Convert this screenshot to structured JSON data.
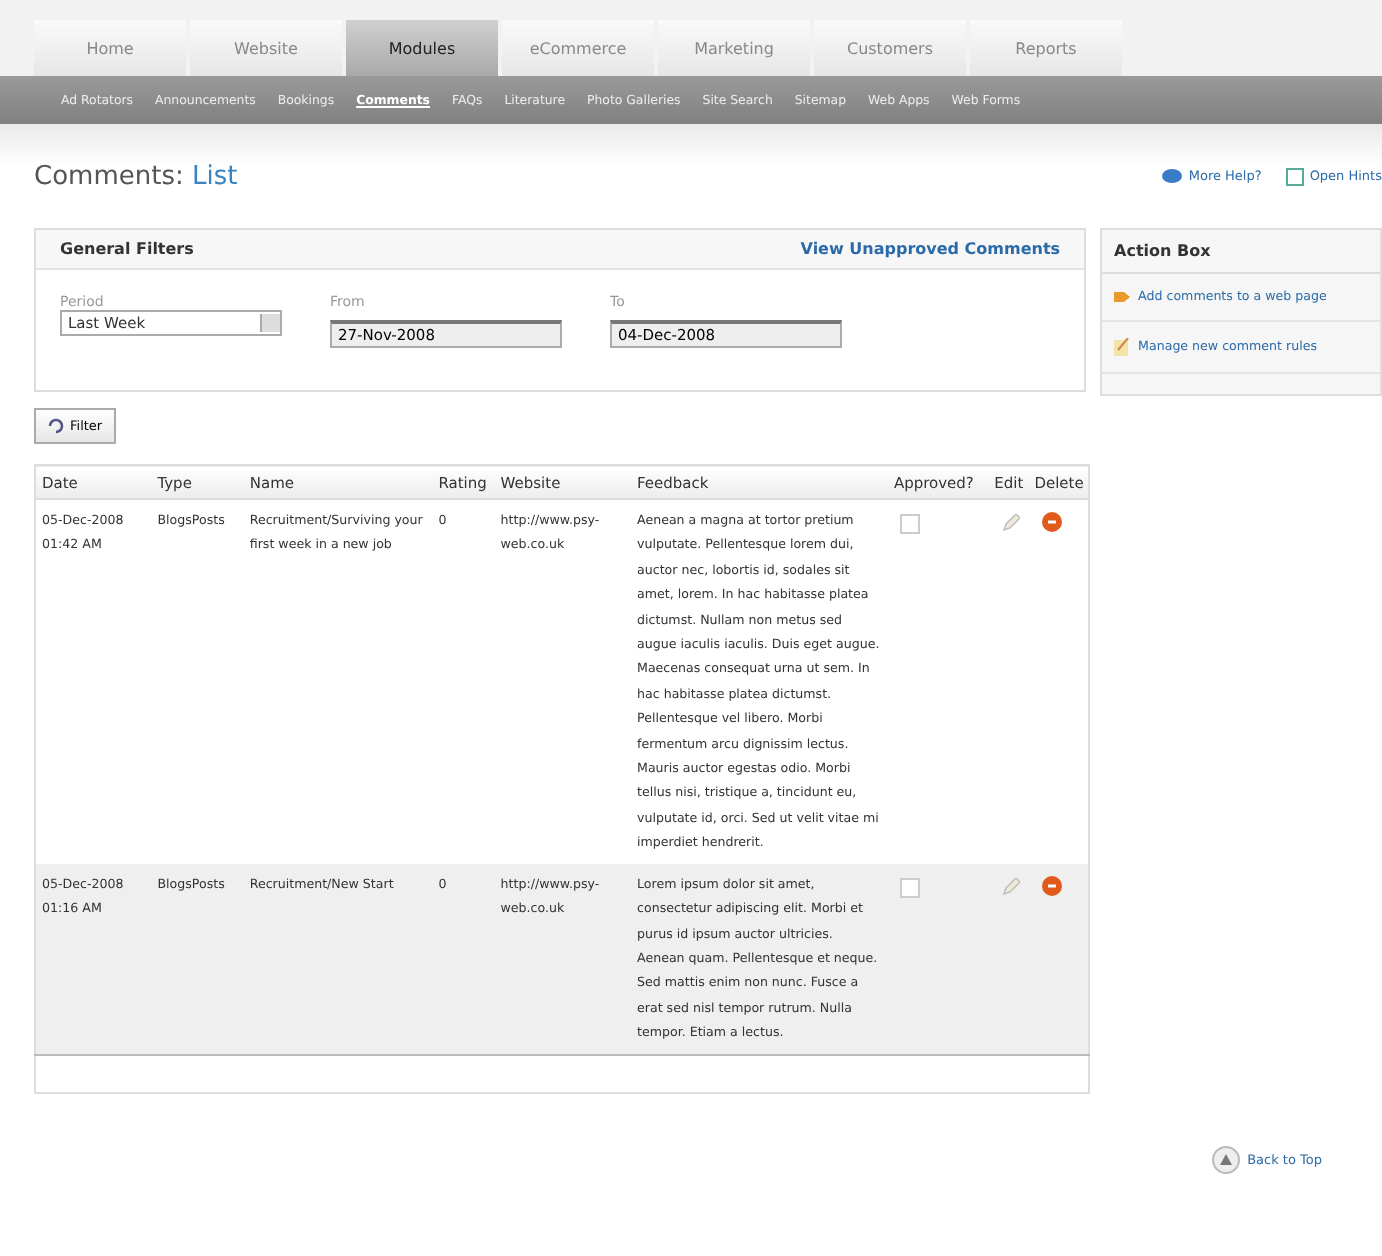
{
  "tabs": [
    {
      "label": "Home",
      "selected": false
    },
    {
      "label": "Website",
      "selected": false
    },
    {
      "label": "Modules",
      "selected": true
    },
    {
      "label": "eCommerce",
      "selected": false
    },
    {
      "label": "Marketing",
      "selected": false
    },
    {
      "label": "Customers",
      "selected": false
    },
    {
      "label": "Reports",
      "selected": false
    }
  ],
  "subnav": [
    {
      "label": "Ad Rotators",
      "selected": false
    },
    {
      "label": "Announcements",
      "selected": false
    },
    {
      "label": "Bookings",
      "selected": false
    },
    {
      "label": "Comments",
      "selected": true
    },
    {
      "label": "FAQs",
      "selected": false
    },
    {
      "label": "Literature",
      "selected": false
    },
    {
      "label": "Photo Galleries",
      "selected": false
    },
    {
      "label": "Site Search",
      "selected": false
    },
    {
      "label": "Sitemap",
      "selected": false
    },
    {
      "label": "Web Apps",
      "selected": false
    },
    {
      "label": "Web Forms",
      "selected": false
    }
  ],
  "page_title": {
    "section": "Comments:",
    "view": "List"
  },
  "help_links": [
    "More Help?",
    "Open Hints"
  ],
  "filters": {
    "title": "General Filters",
    "link": "View Unapproved Comments",
    "period": {
      "label": "Period",
      "value": "Last Week"
    },
    "from": {
      "label": "From",
      "value": "27-Nov-2008"
    },
    "to": {
      "label": "To",
      "value": "04-Dec-2008"
    }
  },
  "action_box": {
    "title": "Action Box",
    "items": [
      {
        "label": "Add comments to a web page",
        "kind": "add"
      },
      {
        "label": "Manage new comment rules",
        "kind": "manage"
      }
    ]
  },
  "filter_button": "Filter",
  "table": {
    "columns": [
      "Date",
      "Type",
      "Name",
      "Rating",
      "Website",
      "Feedback",
      "Approved?",
      "Edit",
      "Delete"
    ],
    "rows": [
      {
        "date": "05-Dec-2008 01:42 AM",
        "type": "BlogsPosts",
        "name": "Recruitment/Surviving your first week in a new job",
        "rating": "0",
        "website": "http://www.psy-web.co.uk",
        "feedback": "Aenean a magna at tortor pretium vulputate. Pellentesque lorem dui, auctor nec, lobortis id, sodales sit amet, lorem. In hac habitasse platea dictumst. Nullam non metus sed augue iaculis iaculis. Duis eget augue. Maecenas consequat urna ut sem. In hac habitasse platea dictumst. Pellentesque vel libero. Morbi fermentum arcu dignissim lectus. Mauris auctor egestas odio. Morbi tellus nisi, tristique a, tincidunt eu, vulputate id, orci. Sed ut velit vitae mi imperdiet hendrerit.",
        "approved": false,
        "selected": false
      },
      {
        "date": "05-Dec-2008 01:16 AM",
        "type": "BlogsPosts",
        "name": "Recruitment/New Start",
        "rating": "0",
        "website": "http://www.psy-web.co.uk",
        "feedback": "Lorem ipsum dolor sit amet, consectetur adipiscing elit. Morbi et purus id ipsum auctor ultricies. Aenean quam. Pellentesque et neque. Sed mattis enim non nunc. Fusce a erat sed nisl tempor rutrum. Nulla tempor. Etiam a lectus.",
        "approved": false,
        "selected": true
      }
    ]
  },
  "back_to_top": "Back to Top"
}
